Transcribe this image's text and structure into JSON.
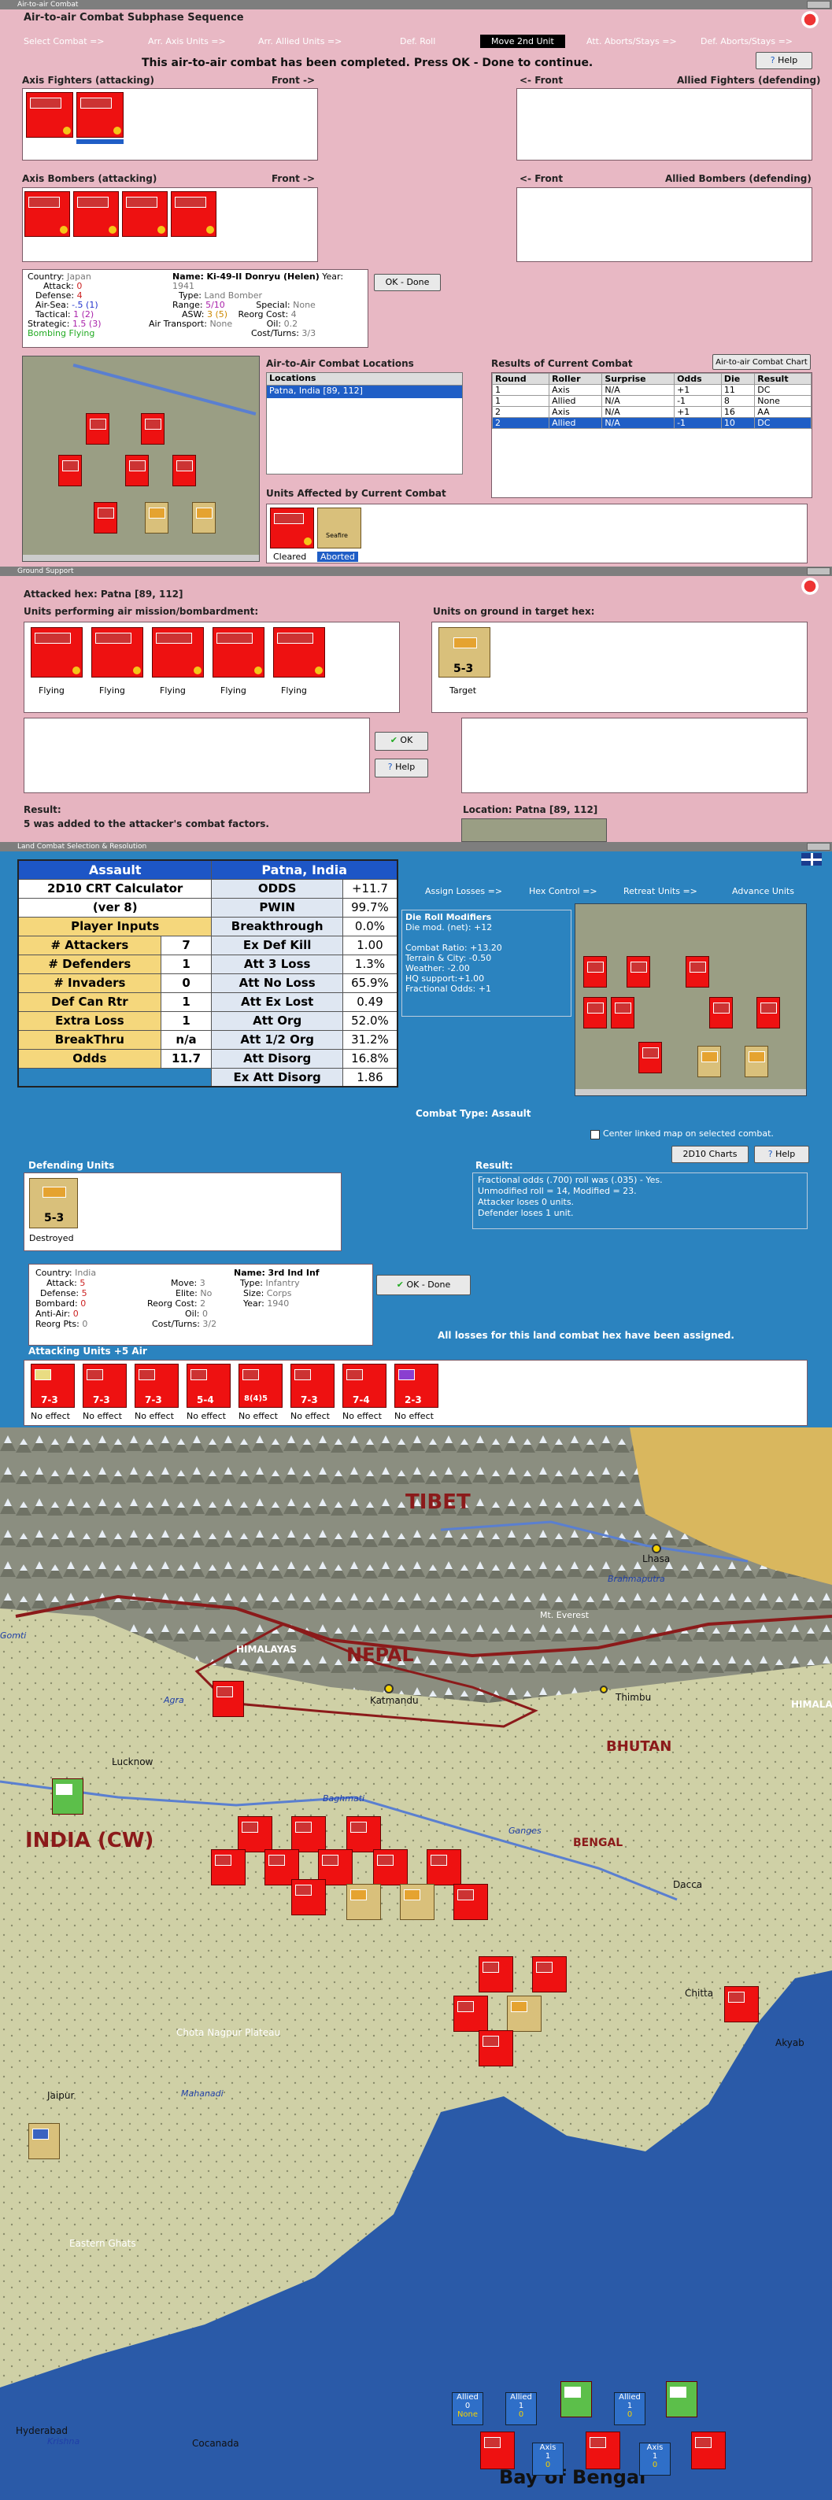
{
  "colors": {
    "panel_pink": "#e8b8c4",
    "panel_blue": "#2e86c1",
    "axis_red": "#e11111",
    "allied_tan": "#d9c07b",
    "highlight": "#1f5ec6"
  },
  "air_combat": {
    "window_title": "Air-to-air Combat",
    "subphase_title": "Air-to-air Combat Subphase Sequence",
    "steps": [
      "Select Combat =>",
      "Arr. Axis Units =>",
      "Arr. Allied Units =>",
      "Def. Roll",
      "Move 2nd Unit",
      "Att. Aborts/Stays =>",
      "Def. Aborts/Stays =>"
    ],
    "help_label": "Help",
    "status_message": "This air-to-air combat has been completed.  Press OK - Done to continue.",
    "axis_fighters_label": "Axis Fighters (attacking)",
    "front_label": "Front ->",
    "allied_front_label": "<- Front",
    "allied_fighters_label": "Allied Fighters (defending)",
    "axis_bombers_label": "Axis Bombers (attacking)",
    "allied_bombers_label": "Allied Bombers (defending)",
    "info": {
      "country_label": "Country:",
      "country": "Japan",
      "attack_label": "Attack:",
      "attack": "0",
      "defense_label": "Defense:",
      "defense": "4",
      "airsea_label": "Air-Sea:",
      "airsea": "-.5 (1)",
      "tactical_label": "Tactical:",
      "tactical": "1 (2)",
      "strategic_label": "Strategic:",
      "strategic": "1.5 (3)",
      "bombing": "Bombing Flying",
      "name_label": "Name:",
      "name": "Ki-49-II Donryu (Helen)",
      "year_label": "Year:",
      "year": "1941",
      "type_label": "Type:",
      "type": "Land Bomber",
      "range_label": "Range:",
      "range": "5/10",
      "special_label": "Special:",
      "special": "None",
      "asw_label": "ASW:",
      "asw": "3 (5)",
      "reorg_label": "Reorg Cost:",
      "reorg": "4",
      "airtrans_label": "Air Transport:",
      "airtrans": "None",
      "oil_label": "Oil:",
      "oil": "0.2",
      "cost_label": "Cost/Turns:",
      "cost": "3/3"
    },
    "ok_done_label": "OK - Done",
    "combat_locations_title": "Air-to-Air Combat Locations",
    "locations_header": "Locations",
    "location_selected": "Patna, India [89, 112]",
    "results_title": "Results of Current Combat",
    "chart_button": "Air-to-air Combat Chart",
    "results_headers": [
      "Round",
      "Roller",
      "Surprise",
      "Odds",
      "Die",
      "Result"
    ],
    "results_rows": [
      [
        "1",
        "Axis",
        "N/A",
        "+1",
        "11",
        "DC"
      ],
      [
        "1",
        "Allied",
        "N/A",
        "-1",
        "8",
        "None"
      ],
      [
        "2",
        "Axis",
        "N/A",
        "+1",
        "16",
        "AA"
      ],
      [
        "2",
        "Allied",
        "N/A",
        "-1",
        "10",
        "DC"
      ]
    ],
    "affected_title": "Units Affected by Current Combat",
    "cleared_label": "Cleared",
    "aborted_label": "Aborted",
    "seafire_label": "Seafire"
  },
  "ground_support": {
    "window_title": "Ground Support",
    "attacked_hex": "Attacked hex: Patna  [89, 112]",
    "performing_label": "Units performing air mission/bombardment:",
    "on_ground_label": "Units on ground in target hex:",
    "unit_status": [
      "Flying",
      "Flying",
      "Flying",
      "Flying",
      "Flying"
    ],
    "target_label": "Target",
    "target_value": "5-3",
    "ok_label": "OK",
    "help_label": "Help",
    "result_label": "Result:",
    "result_text": "5 was added to the attacker's combat factors.",
    "location_text": "Location:  Patna  [89, 112]"
  },
  "land_combat": {
    "window_title": "Land Combat Selection & Resolution",
    "crt": {
      "assault": "Assault",
      "location": "Patna, India",
      "calc_title": "2D10 CRT Calculator",
      "version": "(ver 8)",
      "odds_label": "ODDS",
      "odds_val": "+11.7",
      "pwin_label": "PWIN",
      "pwin_val": "99.7%",
      "player_inputs": "Player Inputs",
      "breakthrough_label": "Breakthrough",
      "breakthrough_val": "0.0%",
      "rows": [
        {
          "l": "# Attackers",
          "v": "7",
          "r": "Ex Def Kill",
          "rv": "1.00"
        },
        {
          "l": "# Defenders",
          "v": "1",
          "r": "Att 3 Loss",
          "rv": "1.3%"
        },
        {
          "l": "# Invaders",
          "v": "0",
          "r": "Att No Loss",
          "rv": "65.9%"
        },
        {
          "l": "Def Can Rtr",
          "v": "1",
          "r": "Att Ex Lost",
          "rv": "0.49"
        },
        {
          "l": "Extra Loss",
          "v": "1",
          "r": "Att Org",
          "rv": "52.0%"
        },
        {
          "l": "BreakThru",
          "v": "n/a",
          "r": "Att 1/2 Org",
          "rv": "31.2%"
        },
        {
          "l": "Odds",
          "v": "11.7",
          "r": "Att Disorg",
          "rv": "16.8%"
        }
      ],
      "ex_att_label": "Ex Att Disorg",
      "ex_att_val": "1.86"
    },
    "tabs": [
      "Assign Losses =>",
      "Hex Control =>",
      "Retreat Units =>",
      "Advance Units"
    ],
    "modifiers_title": "Die Roll Modifiers",
    "modifiers": [
      "Die mod. (net): +12",
      "",
      "Combat Ratio: +13.20",
      "Terrain & City: -0.50",
      "Weather: -2.00",
      "HQ support:+1.00",
      "Fractional Odds: +1"
    ],
    "combat_type": "Combat Type:  Assault",
    "center_map_label": "Center linked map on selected combat.",
    "charts_button": "2D10 Charts",
    "help_label": "Help",
    "result_label": "Result:",
    "result_lines": [
      "Fractional odds (.700) roll was (.035)  - Yes.",
      "Unmodified roll = 14, Modified = 23.",
      "Attacker loses 0 units.",
      "Defender loses 1 unit."
    ],
    "defending_label": "Defending Units",
    "destroyed_label": "Destroyed",
    "unit_info": {
      "country_label": "Country:",
      "country": "India",
      "attack_label": "Attack:",
      "attack": "5",
      "defense_label": "Defense:",
      "defense": "5",
      "bombard_label": "Bombard:",
      "bombard": "0",
      "antiair_label": "Anti-Air:",
      "antiair": "0",
      "reorg_label": "Reorg Pts:",
      "reorg": "0",
      "move_label": "Move:",
      "move": "3",
      "elite_label": "Elite:",
      "elite": "No",
      "reorgcost_label": "Reorg Cost:",
      "reorgcost": "2",
      "oil_label": "Oil:",
      "oil": "0",
      "costturns_label": "Cost/Turns:",
      "costturns": "3/2",
      "name_label": "Name:",
      "name": "3rd Ind Inf",
      "type_label": "Type:",
      "type": "Infantry",
      "size_label": "Size:",
      "size": "Corps",
      "year_label": "Year:",
      "year": "1940"
    },
    "ok_done_label": "OK - Done",
    "all_losses_msg": "All losses for this land combat hex have been assigned.",
    "attacking_label": "Attacking Units +5 Air",
    "attacking_units": [
      {
        "val": "7-3",
        "status": "No effect"
      },
      {
        "val": "7-3",
        "status": "No effect"
      },
      {
        "val": "7-3",
        "status": "No effect"
      },
      {
        "val": "5-4",
        "status": "No effect"
      },
      {
        "val": "8(4)5",
        "status": "No effect"
      },
      {
        "val": "7-3",
        "status": "No effect"
      },
      {
        "val": "7-4",
        "status": "No effect"
      },
      {
        "val": "2-3",
        "status": "No effect"
      }
    ]
  },
  "map": {
    "labels": {
      "tibet": "TIBET",
      "nepal": "NEPAL",
      "himalayas": "HIMALAYAS",
      "bhutan": "BHUTAN",
      "india": "INDIA (CW)",
      "bengal": "BENGAL",
      "bay": "Bay of Bengal",
      "lhasa": "Lhasa",
      "everest": "Mt. Everest",
      "brahmaputra": "Brahmaputra",
      "katmandu": "Katmandu",
      "thimbu": "Thimbu",
      "lucknow": "Lucknow",
      "ganges": "Ganges",
      "baghmati": "Baghmati",
      "dacca": "Dacca",
      "chittagong": "Chitta",
      "akyab": "Akyab",
      "chota": "Chota Nagpur Plateau",
      "mahanadi": "Mahanadi",
      "eastern_ghats": "Eastern Ghats",
      "hyderabad": "Hyderabad",
      "cocanada": "Cocanada",
      "krishna": "Krishna",
      "jaipur": "Jaipur",
      "agra": "Agra",
      "gomti": "Gomti",
      "himala": "HIMALA"
    },
    "stack": [
      {
        "side": "Allied",
        "val": "0",
        "sub": "None"
      },
      {
        "side": "Allied",
        "val": "1",
        "sub": "0"
      },
      {
        "side": "Allied",
        "val": "1",
        "sub": "0"
      },
      {
        "side": "Axis",
        "val": "1",
        "sub": "0"
      },
      {
        "side": "Axis",
        "val": "1",
        "sub": "0"
      }
    ]
  }
}
